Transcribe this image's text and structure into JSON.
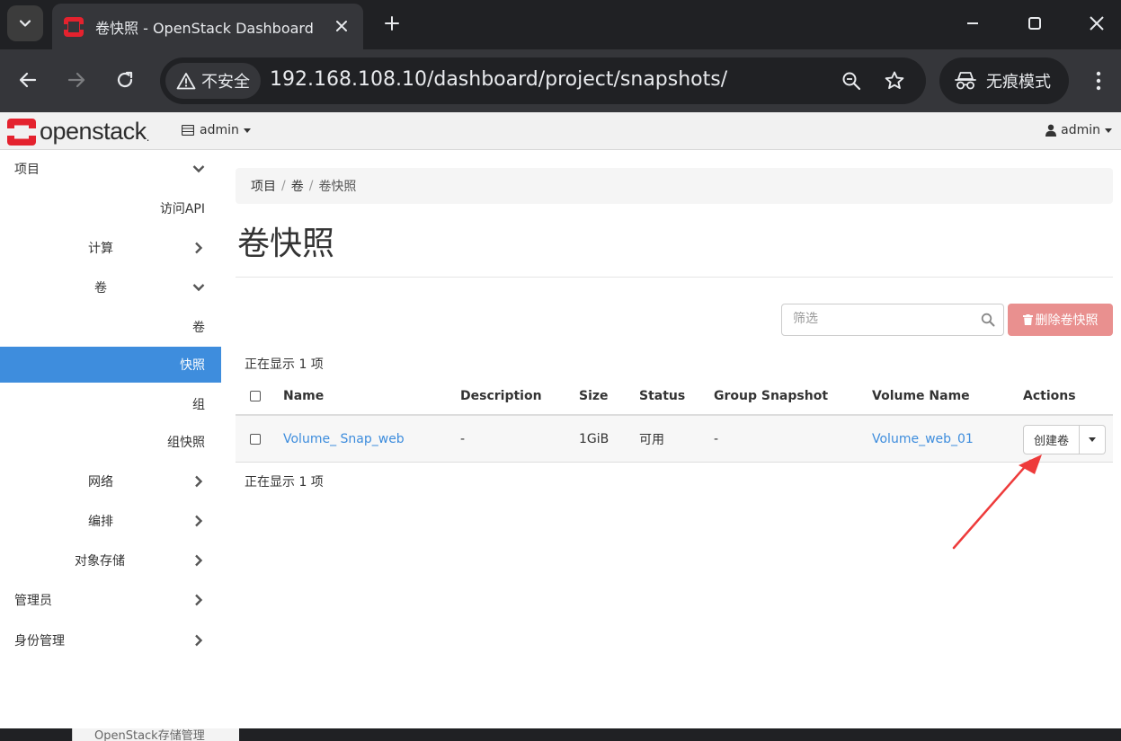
{
  "browser": {
    "tab_title": "卷快照 - OpenStack Dashboard",
    "security_label": "不安全",
    "url": "192.168.108.10/dashboard/project/snapshots/",
    "incognito_label": "无痕模式"
  },
  "header": {
    "logo_text": "openstack",
    "logo_mark": ".",
    "project": "admin",
    "user": "admin"
  },
  "sidebar": {
    "items": [
      {
        "label": "项目",
        "level": 0,
        "chevron": "down"
      },
      {
        "label": "访问API",
        "level": 2
      },
      {
        "label": "计算",
        "level": 1,
        "chevron": "right"
      },
      {
        "label": "卷",
        "level": 1,
        "chevron": "down"
      },
      {
        "label": "卷",
        "level": 2
      },
      {
        "label": "快照",
        "level": 2,
        "active": true
      },
      {
        "label": "组",
        "level": 2
      },
      {
        "label": "组快照",
        "level": 2
      },
      {
        "label": "网络",
        "level": 1,
        "chevron": "right"
      },
      {
        "label": "编排",
        "level": 1,
        "chevron": "right"
      },
      {
        "label": "对象存储",
        "level": 1,
        "chevron": "right"
      },
      {
        "label": "管理员",
        "level": 0,
        "chevron": "right"
      },
      {
        "label": "身份管理",
        "level": 0,
        "chevron": "right"
      }
    ]
  },
  "breadcrumb": [
    "项目",
    "卷",
    "卷快照"
  ],
  "page_title": "卷快照",
  "filter_placeholder": "筛选",
  "delete_button": "删除卷快照",
  "count_text": "正在显示 1 项",
  "table": {
    "columns": [
      "Name",
      "Description",
      "Size",
      "Status",
      "Group Snapshot",
      "Volume Name",
      "Actions"
    ],
    "rows": [
      {
        "name": "Volume_ Snap_web",
        "description": "-",
        "size": "1GiB",
        "status": "可用",
        "group_snapshot": "-",
        "volume_name": "Volume_web_01",
        "action": "创建卷"
      }
    ]
  },
  "background_window_text": "OpenStack存储管理",
  "colors": {
    "accent": "#3e8ddd",
    "danger_disabled": "#e9908f",
    "annotation_arrow": "#ee3b3b",
    "openstack_red": "#e4222e"
  }
}
